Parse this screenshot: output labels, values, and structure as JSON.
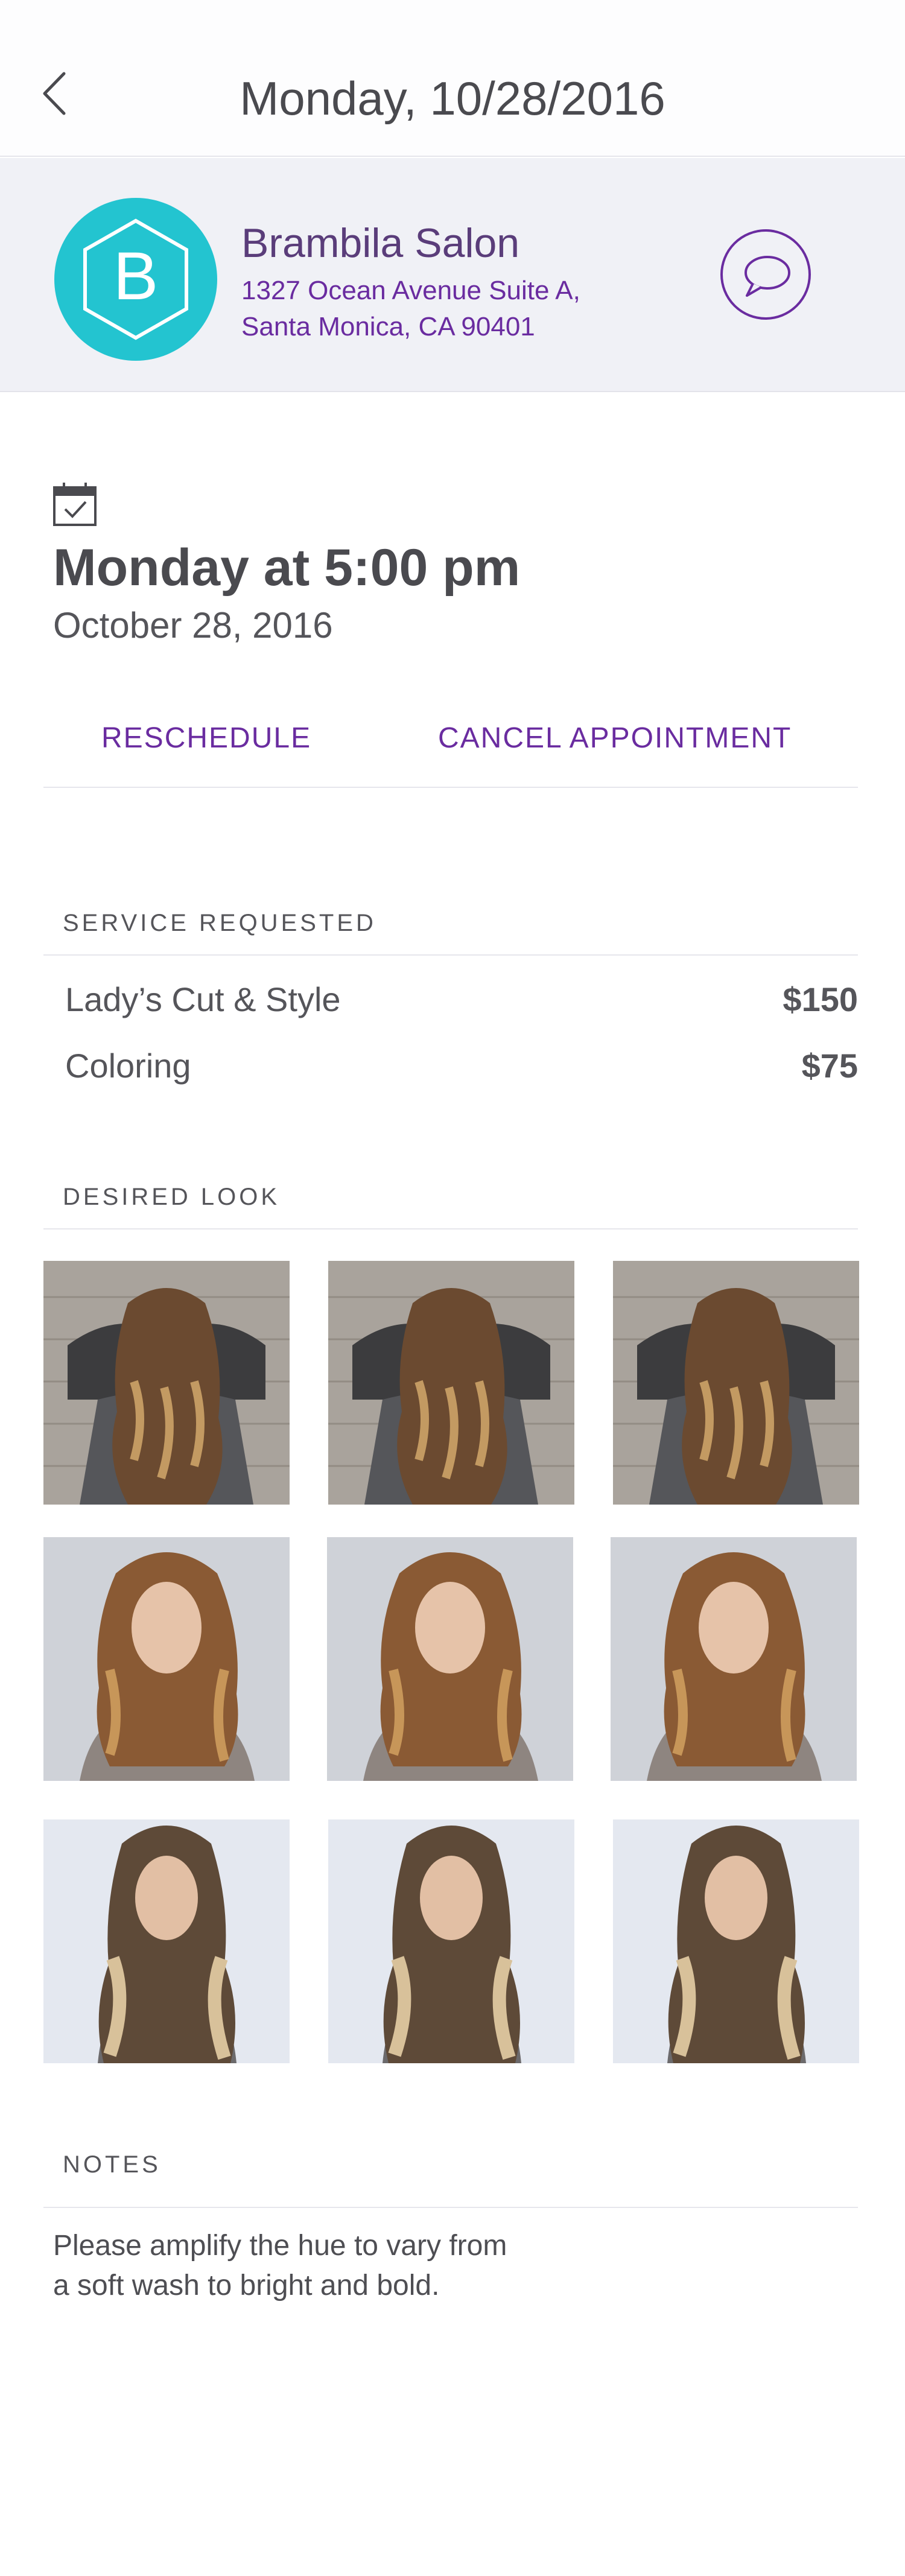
{
  "header": {
    "title": "Monday, 10/28/2016"
  },
  "salon": {
    "name": "Brambila Salon",
    "address_line1": "1327 Ocean Avenue Suite A,",
    "address_line2": "Santa Monica, CA 90401",
    "logo_letter": "B",
    "logo_color": "#23c4d0"
  },
  "appointment": {
    "time": "Monday at 5:00 pm",
    "date": "October 28, 2016"
  },
  "actions": {
    "reschedule": "RESCHEDULE",
    "cancel": "CANCEL APPOINTMENT"
  },
  "services": {
    "label": "SERVICE REQUESTED",
    "items": [
      {
        "name": "Lady’s Cut & Style",
        "price": "$150"
      },
      {
        "name": "Coloring",
        "price": "$75"
      }
    ]
  },
  "desired_look": {
    "label": "DESIRED LOOK",
    "photos": [
      "wavy-hair-back-photo",
      "wavy-hair-back-photo",
      "wavy-hair-back-photo",
      "long-wavy-hair-model-photo",
      "long-wavy-hair-model-photo",
      "long-wavy-hair-model-photo",
      "ombre-waves-model-photo",
      "ombre-waves-model-photo",
      "ombre-waves-model-photo"
    ]
  },
  "notes": {
    "label": "NOTES",
    "line1": "Please amplify the hue to vary from",
    "line2": "a soft wash to bright and bold."
  },
  "colors": {
    "accent_purple": "#6a2ca0",
    "salon_name_purple": "#5a3d7a",
    "header_band": "#f0f1f6"
  }
}
